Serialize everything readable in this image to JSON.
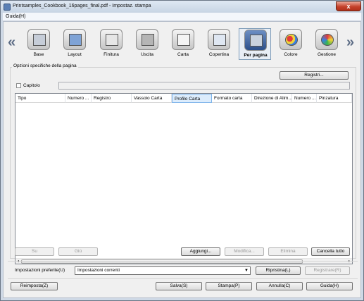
{
  "window": {
    "title": "Printsamples_Cookbook_16pages_final.pdf - Impostaz. stampa",
    "close_label": "x"
  },
  "menu": {
    "help_label": "Guida(H)"
  },
  "nav": {
    "left_arrow": "«",
    "right_arrow": "»"
  },
  "tabs": [
    {
      "label": "Base",
      "icon": "printer-basic-icon"
    },
    {
      "label": "Layout",
      "icon": "layout-icon"
    },
    {
      "label": "Finitura",
      "icon": "finishing-icon"
    },
    {
      "label": "Uscita",
      "icon": "output-tray-icon"
    },
    {
      "label": "Carta",
      "icon": "paper-icon"
    },
    {
      "label": "Copertina",
      "icon": "cover-icon"
    },
    {
      "label": "Per pagina",
      "icon": "per-page-icon",
      "active": true
    },
    {
      "label": "Colore",
      "icon": "color-icon"
    },
    {
      "label": "Gestione",
      "icon": "management-icon"
    }
  ],
  "page_options": {
    "group_label": "Opzioni specifiche della pagina",
    "registers_button": "Registri...",
    "chapter_label": "Capitolo",
    "chapter_checked": false,
    "chapter_value": ""
  },
  "table": {
    "columns": [
      "Tipo",
      "Numero ...",
      "Registro",
      "Vassoio Carta",
      "Profilo Carta",
      "Formato carta",
      "Direzione di Alim...",
      "Numero ...",
      "Pinzatura"
    ],
    "rows": []
  },
  "table_buttons": {
    "up": "Su",
    "down": "Giù",
    "add": "Aggiungi...",
    "edit": "Modifica...",
    "delete": "Elimina",
    "clear_all": "Cancella tutto"
  },
  "favorites": {
    "label": "Impostazioni preferite(U)",
    "selected": "Impostazioni correnti",
    "restore": "Ripristina(L)",
    "register": "Registrare(R)"
  },
  "footer": {
    "reset": "Reimposta(Z)",
    "save": "Salva(S)",
    "print": "Stampa(P)",
    "cancel": "Annulla(C)",
    "help": "Guida(H)"
  }
}
